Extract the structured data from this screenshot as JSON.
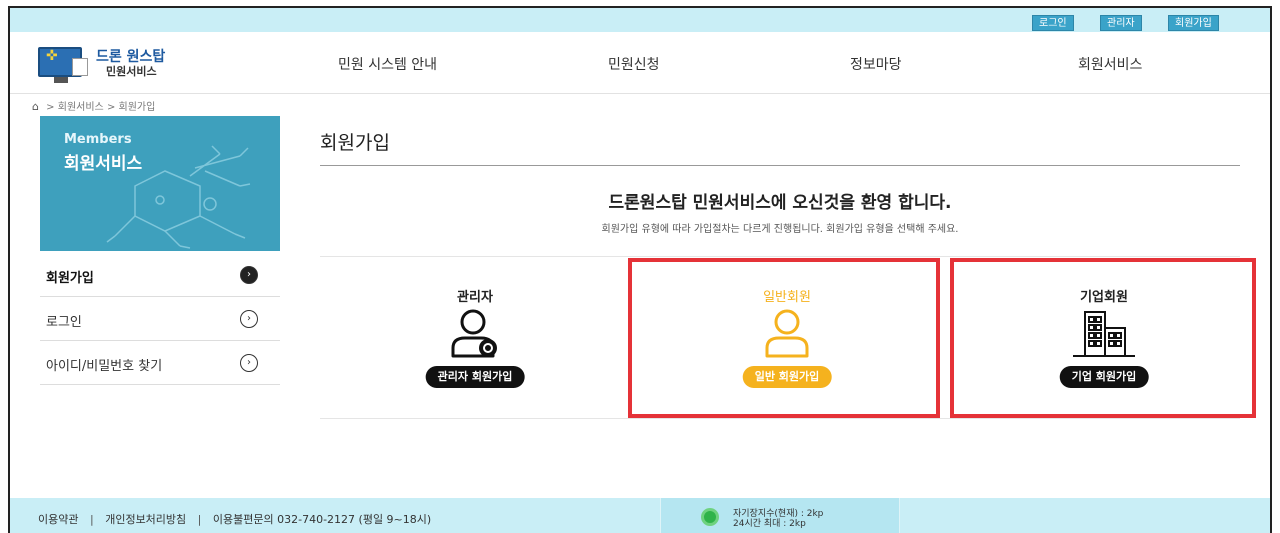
{
  "util_links": [
    "로그인",
    "관리자",
    "회원가입"
  ],
  "logo": {
    "title": "드론 원스탑",
    "subtitle": "민원서비스"
  },
  "gnb": [
    "민원 시스템 안내",
    "민원신청",
    "정보마당",
    "회원서비스"
  ],
  "breadcrumb": {
    "level1": "회원서비스",
    "level2": "회원가입",
    "sep": ">"
  },
  "sidebar": {
    "banner_en": "Members",
    "banner_ko": "회원서비스",
    "items": [
      {
        "label": "회원가입",
        "active": true
      },
      {
        "label": "로그인",
        "active": false
      },
      {
        "label": "아이디/비밀번호 찾기",
        "active": false
      }
    ]
  },
  "main": {
    "title": "회원가입",
    "welcome": "드론원스탑 민원서비스에 오신것을 환영 합니다.",
    "subtext": "회원가입 유형에 따라 가입절차는 다르게 진행됩니다. 회원가입 유형을 선택해 주세요.",
    "cards": [
      {
        "title": "관리자",
        "button": "관리자 회원가입",
        "icon": "admin-user-icon"
      },
      {
        "title": "일반회원",
        "button": "일반 회원가입",
        "icon": "user-icon",
        "accent": "#f5b21e"
      },
      {
        "title": "기업회원",
        "button": "기업 회원가입",
        "icon": "building-icon"
      }
    ]
  },
  "footer": {
    "links": [
      "이용약관",
      "개인정보처리방침",
      "이용불편문의 032-740-2127 (평일 9~18시)"
    ],
    "separator": "|",
    "status_line1": "자기장지수(현재) : 2kp",
    "status_line2": "24시간 최대      : 2kp"
  },
  "colors": {
    "topbar": "#c9eef6",
    "accent": "#3ea0bd",
    "orange": "#f5b21e",
    "highlight": "#e53238"
  }
}
